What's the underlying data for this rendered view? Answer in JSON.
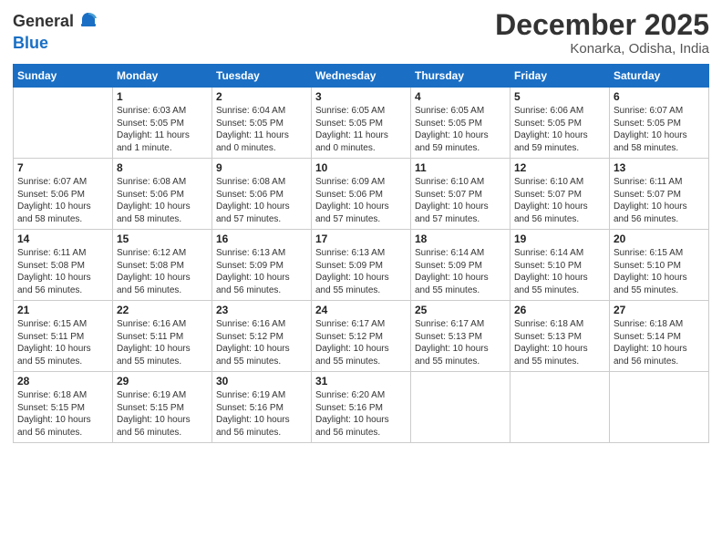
{
  "header": {
    "logo_general": "General",
    "logo_blue": "Blue",
    "month_title": "December 2025",
    "location": "Konarka, Odisha, India"
  },
  "days_of_week": [
    "Sunday",
    "Monday",
    "Tuesday",
    "Wednesday",
    "Thursday",
    "Friday",
    "Saturday"
  ],
  "weeks": [
    [
      {
        "day": "",
        "info": ""
      },
      {
        "day": "1",
        "info": "Sunrise: 6:03 AM\nSunset: 5:05 PM\nDaylight: 11 hours\nand 1 minute."
      },
      {
        "day": "2",
        "info": "Sunrise: 6:04 AM\nSunset: 5:05 PM\nDaylight: 11 hours\nand 0 minutes."
      },
      {
        "day": "3",
        "info": "Sunrise: 6:05 AM\nSunset: 5:05 PM\nDaylight: 11 hours\nand 0 minutes."
      },
      {
        "day": "4",
        "info": "Sunrise: 6:05 AM\nSunset: 5:05 PM\nDaylight: 10 hours\nand 59 minutes."
      },
      {
        "day": "5",
        "info": "Sunrise: 6:06 AM\nSunset: 5:05 PM\nDaylight: 10 hours\nand 59 minutes."
      },
      {
        "day": "6",
        "info": "Sunrise: 6:07 AM\nSunset: 5:05 PM\nDaylight: 10 hours\nand 58 minutes."
      }
    ],
    [
      {
        "day": "7",
        "info": "Sunrise: 6:07 AM\nSunset: 5:06 PM\nDaylight: 10 hours\nand 58 minutes."
      },
      {
        "day": "8",
        "info": "Sunrise: 6:08 AM\nSunset: 5:06 PM\nDaylight: 10 hours\nand 58 minutes."
      },
      {
        "day": "9",
        "info": "Sunrise: 6:08 AM\nSunset: 5:06 PM\nDaylight: 10 hours\nand 57 minutes."
      },
      {
        "day": "10",
        "info": "Sunrise: 6:09 AM\nSunset: 5:06 PM\nDaylight: 10 hours\nand 57 minutes."
      },
      {
        "day": "11",
        "info": "Sunrise: 6:10 AM\nSunset: 5:07 PM\nDaylight: 10 hours\nand 57 minutes."
      },
      {
        "day": "12",
        "info": "Sunrise: 6:10 AM\nSunset: 5:07 PM\nDaylight: 10 hours\nand 56 minutes."
      },
      {
        "day": "13",
        "info": "Sunrise: 6:11 AM\nSunset: 5:07 PM\nDaylight: 10 hours\nand 56 minutes."
      }
    ],
    [
      {
        "day": "14",
        "info": "Sunrise: 6:11 AM\nSunset: 5:08 PM\nDaylight: 10 hours\nand 56 minutes."
      },
      {
        "day": "15",
        "info": "Sunrise: 6:12 AM\nSunset: 5:08 PM\nDaylight: 10 hours\nand 56 minutes."
      },
      {
        "day": "16",
        "info": "Sunrise: 6:13 AM\nSunset: 5:09 PM\nDaylight: 10 hours\nand 56 minutes."
      },
      {
        "day": "17",
        "info": "Sunrise: 6:13 AM\nSunset: 5:09 PM\nDaylight: 10 hours\nand 55 minutes."
      },
      {
        "day": "18",
        "info": "Sunrise: 6:14 AM\nSunset: 5:09 PM\nDaylight: 10 hours\nand 55 minutes."
      },
      {
        "day": "19",
        "info": "Sunrise: 6:14 AM\nSunset: 5:10 PM\nDaylight: 10 hours\nand 55 minutes."
      },
      {
        "day": "20",
        "info": "Sunrise: 6:15 AM\nSunset: 5:10 PM\nDaylight: 10 hours\nand 55 minutes."
      }
    ],
    [
      {
        "day": "21",
        "info": "Sunrise: 6:15 AM\nSunset: 5:11 PM\nDaylight: 10 hours\nand 55 minutes."
      },
      {
        "day": "22",
        "info": "Sunrise: 6:16 AM\nSunset: 5:11 PM\nDaylight: 10 hours\nand 55 minutes."
      },
      {
        "day": "23",
        "info": "Sunrise: 6:16 AM\nSunset: 5:12 PM\nDaylight: 10 hours\nand 55 minutes."
      },
      {
        "day": "24",
        "info": "Sunrise: 6:17 AM\nSunset: 5:12 PM\nDaylight: 10 hours\nand 55 minutes."
      },
      {
        "day": "25",
        "info": "Sunrise: 6:17 AM\nSunset: 5:13 PM\nDaylight: 10 hours\nand 55 minutes."
      },
      {
        "day": "26",
        "info": "Sunrise: 6:18 AM\nSunset: 5:13 PM\nDaylight: 10 hours\nand 55 minutes."
      },
      {
        "day": "27",
        "info": "Sunrise: 6:18 AM\nSunset: 5:14 PM\nDaylight: 10 hours\nand 56 minutes."
      }
    ],
    [
      {
        "day": "28",
        "info": "Sunrise: 6:18 AM\nSunset: 5:15 PM\nDaylight: 10 hours\nand 56 minutes."
      },
      {
        "day": "29",
        "info": "Sunrise: 6:19 AM\nSunset: 5:15 PM\nDaylight: 10 hours\nand 56 minutes."
      },
      {
        "day": "30",
        "info": "Sunrise: 6:19 AM\nSunset: 5:16 PM\nDaylight: 10 hours\nand 56 minutes."
      },
      {
        "day": "31",
        "info": "Sunrise: 6:20 AM\nSunset: 5:16 PM\nDaylight: 10 hours\nand 56 minutes."
      },
      {
        "day": "",
        "info": ""
      },
      {
        "day": "",
        "info": ""
      },
      {
        "day": "",
        "info": ""
      }
    ]
  ]
}
